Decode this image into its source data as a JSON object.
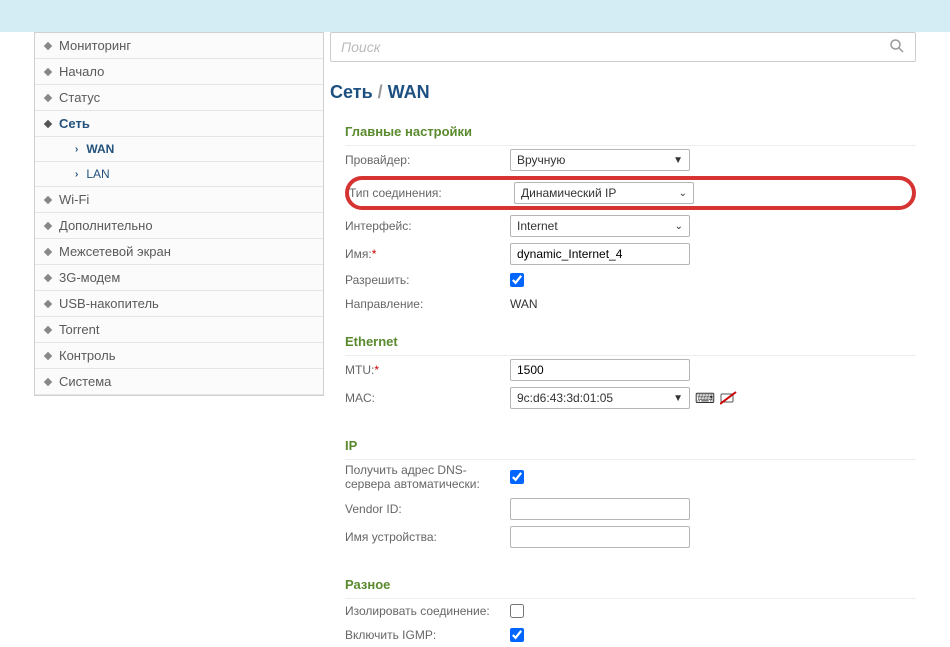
{
  "search": {
    "placeholder": "Поиск"
  },
  "breadcrumb": {
    "part1": "Сеть",
    "sep": " / ",
    "part2": "WAN"
  },
  "sidebar": {
    "items": [
      "Мониторинг",
      "Начало",
      "Статус",
      "Сеть",
      "Wi-Fi",
      "Дополнительно",
      "Межсетевой экран",
      "3G-модем",
      "USB-накопитель",
      "Torrent",
      "Контроль",
      "Система"
    ],
    "sub": {
      "wan": "WAN",
      "lan": "LAN"
    }
  },
  "sections": {
    "main": "Главные настройки",
    "ethernet": "Ethernet",
    "ip": "IP",
    "misc": "Разное"
  },
  "labels": {
    "provider": "Провайдер:",
    "conn_type": "Тип соединения:",
    "interface": "Интерфейс:",
    "name": "Имя:",
    "allow": "Разрешить:",
    "direction": "Направление:",
    "mtu": "MTU:",
    "mac": "MAC:",
    "dns_auto": "Получить адрес DNS-сервера автоматически:",
    "vendor_id": "Vendor ID:",
    "device_name": "Имя устройства:",
    "isolate": "Изолировать соединение:",
    "igmp": "Включить IGMP:",
    "req": "*"
  },
  "values": {
    "provider": "Вручную",
    "conn_type": "Динамический IP",
    "interface": "Internet",
    "name": "dynamic_Internet_4",
    "allow": true,
    "direction": "WAN",
    "mtu": "1500",
    "mac": "9c:d6:43:3d:01:05",
    "dns_auto": true,
    "vendor_id": "",
    "device_name": "",
    "isolate": false,
    "igmp": true
  }
}
